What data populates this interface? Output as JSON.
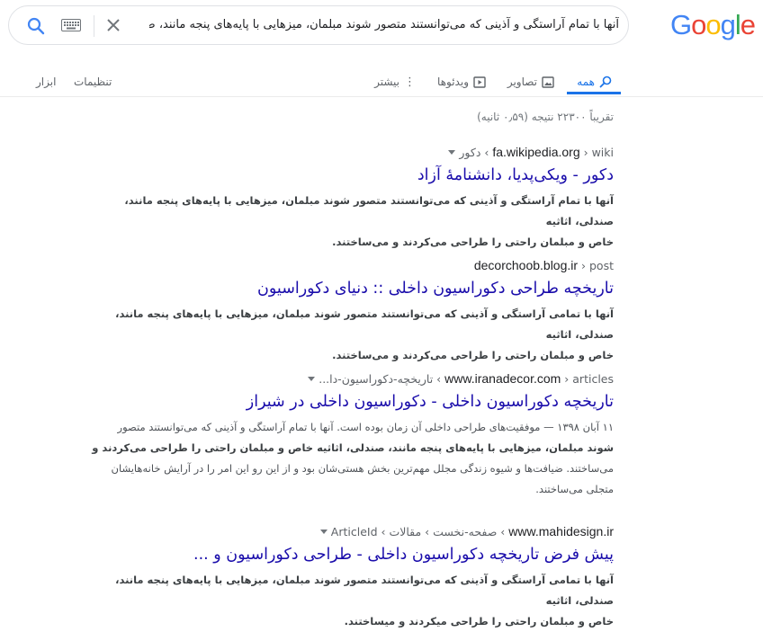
{
  "logo": {
    "text": "Google"
  },
  "search": {
    "query": "آنها با تمام آراستگی و آذینی که می‌توانستند متصور شوند مبلمان، میزهایی با پایه‌های پنجه مانند، صندلی"
  },
  "tabs": {
    "all": "همه",
    "images": "تصاویر",
    "videos": "ویدئوها",
    "more": "بیشتر",
    "settings": "تنظیمات",
    "tools": "ابزار"
  },
  "stats": "تقریباً ۲۲۳۰۰ نتیجه (۰٫۵۹ ثانیه)",
  "results": [
    {
      "host": "fa.wikipedia.org",
      "path": " › wiki › دکور",
      "title": "دکور - ویکی‌پدیا، دانشنامهٔ آزاد",
      "snippet_l1": "آنها با تمام آراستگی و آذینی که می‌توانستند متصور شوند مبلمان، میزهایی با پایه‌های پنجه مانند، صندلی، اثاثیه",
      "snippet_l2": "خاص و مبلمان راحتی را طراحی می‌کردند و می‌ساختند."
    },
    {
      "host": "decorchoob.blog.ir",
      "path": " › post",
      "title": "تاریخچه طراحی دکوراسیون داخلی :: دنیای دکوراسیون",
      "snippet_l1": "آنها با تمامی آراستگی و آذینی که می‌توانستند متصور شوند مبلمان، میزهایی با پایه‌های پنجه مانند، صندلی، اثاثیه",
      "snippet_l2": "خاص و مبلمان راحتی را طراحی می‌کردند و می‌ساختند."
    },
    {
      "host": "www.iranadecor.com",
      "path": " › articles › تاریخچه-دکوراسیون-دا...",
      "title": "تاریخچه دکوراسیون داخلی - دکوراسیون داخلی در شیراز",
      "snippet_l1": "۱۱ آبان ۱۳۹۸ — موفقیت‌های طراحی داخلی آن زمان بوده است. آنها با تمام آراستگی و آذینی که می‌توانستند متصور",
      "snippet_l2": "شوند مبلمان، میزهایی با پایه‌های پنجه مانند، صندلی، اثاثیه خاص و مبلمان راحتی را طراحی می‌کردند و",
      "snippet_l3": "می‌ساختند. ضیافت‌ها و شیوه زندگی مجلل مهم‌ترین بخش هستی‌شان بود و از این رو این امر را در آرایش خانه‌هایشان",
      "snippet_l4": "متجلی می‌ساختند."
    },
    {
      "host": "www.mahidesign.ir",
      "path": " › صفحه-نخست › مقالات › ArticleId",
      "title": "پیش فرض تاریخچه دکوراسیون داخلی - طراحی دکوراسیون و ...",
      "snippet_l1": "آنها با تمامی آراستگی و آذینی که می‌توانستند متصور شوند مبلمان، میزهایی با پایه‌های پنجه مانند، صندلی، اثاثیه",
      "snippet_l2": "خاص و مبلمان راحتی را طراحی میکردند و میساختند."
    }
  ],
  "colors": {
    "link": "#1a0dab",
    "accent": "#1a73e8",
    "muted": "#70757a"
  }
}
